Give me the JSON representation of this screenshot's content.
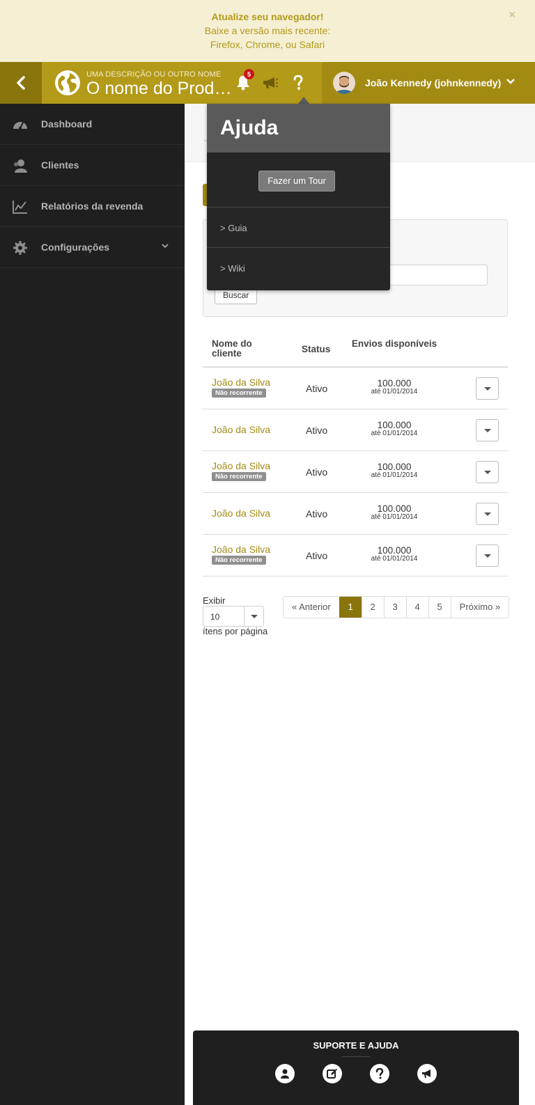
{
  "banner": {
    "title": "Atualize seu navegador!",
    "line1": "Baixe a versão mais recente:",
    "line2": "Firefox, Chrome, ou Safari",
    "close_label": "×"
  },
  "header": {
    "description": "UMA DESCRIÇÃO OU OUTRO NOME",
    "product_name": "O nome do Produto",
    "notification_count": "5",
    "user_name": "João Kennedy (johnkennedy)"
  },
  "sidebar": {
    "items": [
      {
        "label": "Dashboard",
        "icon": "dashboard-icon"
      },
      {
        "label": "Clientes",
        "icon": "users-icon"
      },
      {
        "label": "Relatórios da revenda",
        "icon": "chart-icon"
      },
      {
        "label": "Configurações",
        "icon": "gear-icon"
      }
    ]
  },
  "help": {
    "title": "Ajuda",
    "tour_label": "Fazer um Tour",
    "links": [
      "> Guia",
      "> Wiki"
    ]
  },
  "search": {
    "button_label": "Buscar"
  },
  "table": {
    "headers": {
      "name": "Nome do cliente",
      "status": "Status",
      "envios": "Envios disponíveis"
    },
    "rows": [
      {
        "name": "João da Silva",
        "tag": "Não recorrente",
        "status": "Ativo",
        "value": "100.000",
        "until": "até 01/01/2014"
      },
      {
        "name": "João da Silva",
        "tag": "",
        "status": "Ativo",
        "value": "100.000",
        "until": "até 01/01/2014"
      },
      {
        "name": "João da Silva",
        "tag": "Não recorrente",
        "status": "Ativo",
        "value": "100.000",
        "until": "até 01/01/2014"
      },
      {
        "name": "João da Silva",
        "tag": "",
        "status": "Ativo",
        "value": "100.000",
        "until": "até 01/01/2014"
      },
      {
        "name": "João da Silva",
        "tag": "Não recorrente",
        "status": "Ativo",
        "value": "100.000",
        "until": "até 01/01/2014"
      }
    ]
  },
  "pagination": {
    "show_label": "Exibir",
    "per_page_value": "10",
    "per_page_suffix": "ítens por página",
    "prev_label": "« Anterior",
    "next_label": "Próximo »",
    "pages": [
      "1",
      "2",
      "3",
      "4",
      "5"
    ],
    "current_page": "1"
  },
  "footer": {
    "title": "SUPORTE E AJUDA",
    "icons": [
      "user-icon",
      "edit-icon",
      "help-icon",
      "megaphone-icon"
    ]
  },
  "colors": {
    "accent": "#a38b13",
    "accent_dark": "#8a740c",
    "sidebar_bg": "#1f1f1f",
    "banner_bg": "#f5efd4",
    "badge": "#cc1616"
  }
}
